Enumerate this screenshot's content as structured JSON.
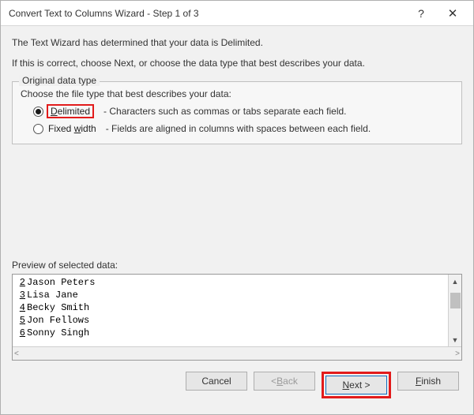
{
  "window": {
    "title": "Convert Text to Columns Wizard - Step 1 of 3",
    "help": "?",
    "close": "✕"
  },
  "intro": {
    "line1": "The Text Wizard has determined that your data is Delimited.",
    "line2": "If this is correct, choose Next, or choose the data type that best describes your data."
  },
  "group": {
    "legend": "Original data type",
    "prompt": "Choose the file type that best describes your data:",
    "options": {
      "delimited": {
        "label_u": "D",
        "label_rest": "elimited",
        "desc": "- Characters such as commas or tabs separate each field."
      },
      "fixed": {
        "label_pre": "Fixed ",
        "label_u": "w",
        "label_rest": "idth",
        "desc": "- Fields are aligned in columns with spaces between each field."
      }
    }
  },
  "preview": {
    "label": "Preview of selected data:",
    "rows": [
      {
        "n": "2",
        "v": "Jason Peters"
      },
      {
        "n": "3",
        "v": "Lisa Jane"
      },
      {
        "n": "4",
        "v": "Becky Smith"
      },
      {
        "n": "5",
        "v": "Jon Fellows"
      },
      {
        "n": "6",
        "v": "Sonny Singh"
      }
    ]
  },
  "buttons": {
    "cancel": "Cancel",
    "back_lt": "< ",
    "back_u": "B",
    "back_rest": "ack",
    "next_u": "N",
    "next_rest": "ext >",
    "finish_u": "F",
    "finish_rest": "inish"
  }
}
